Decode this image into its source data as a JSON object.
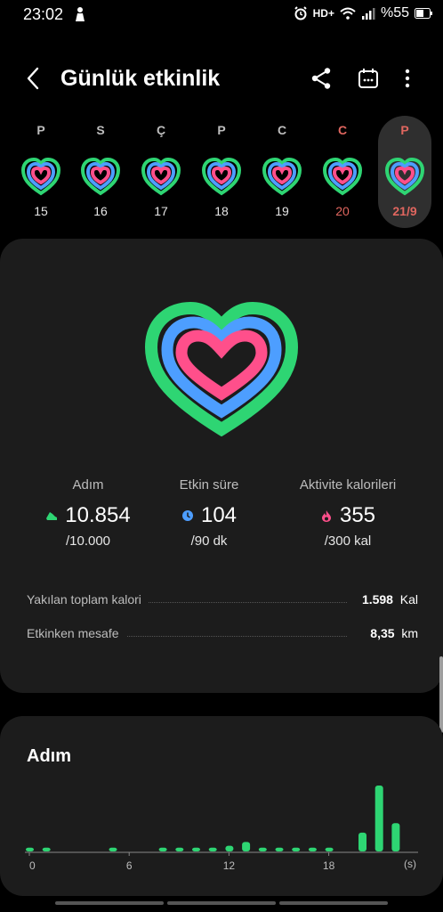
{
  "status": {
    "time": "23:02",
    "hd": "HD+",
    "battery": "%55"
  },
  "header": {
    "title": "Günlük etkinlik"
  },
  "days": [
    {
      "dow": "P",
      "num": "15",
      "weekend": false,
      "selected": false
    },
    {
      "dow": "S",
      "num": "16",
      "weekend": false,
      "selected": false
    },
    {
      "dow": "Ç",
      "num": "17",
      "weekend": false,
      "selected": false
    },
    {
      "dow": "P",
      "num": "18",
      "weekend": false,
      "selected": false
    },
    {
      "dow": "C",
      "num": "19",
      "weekend": false,
      "selected": false
    },
    {
      "dow": "C",
      "num": "20",
      "weekend": true,
      "selected": false
    },
    {
      "dow": "P",
      "num": "21/9",
      "weekend": true,
      "selected": true
    }
  ],
  "metrics": {
    "steps": {
      "label": "Adım",
      "value": "10.854",
      "goal": "/10.000",
      "icon": "shoe-icon",
      "color": "#2ed573"
    },
    "active_time": {
      "label": "Etkin süre",
      "value": "104",
      "goal": "/90 dk",
      "icon": "clock-icon",
      "color": "#4d9eff"
    },
    "calories": {
      "label": "Aktivite kalorileri",
      "value": "355",
      "goal": "/300 kal",
      "icon": "flame-icon",
      "color": "#ff4f8b"
    }
  },
  "summary": {
    "total_calories": {
      "label": "Yakılan toplam kalori",
      "value": "1.598",
      "unit": "Kal"
    },
    "distance": {
      "label": "Etkinken mesafe",
      "value": "8,35",
      "unit": "km"
    }
  },
  "steps_section": {
    "title": "Adım"
  },
  "chart_data": {
    "type": "bar",
    "x": [
      0,
      1,
      2,
      3,
      4,
      5,
      6,
      7,
      8,
      9,
      10,
      11,
      12,
      13,
      14,
      15,
      16,
      17,
      18,
      19,
      20,
      21,
      22,
      23
    ],
    "values": [
      2,
      2,
      0,
      0,
      0,
      2,
      0,
      0,
      2,
      2,
      2,
      2,
      3,
      5,
      2,
      2,
      2,
      2,
      2,
      0,
      10,
      35,
      15,
      0
    ],
    "xticks": [
      "0",
      "6",
      "12",
      "18"
    ],
    "xunit": "(s)",
    "color": "#2ed573",
    "ymax": 35
  }
}
